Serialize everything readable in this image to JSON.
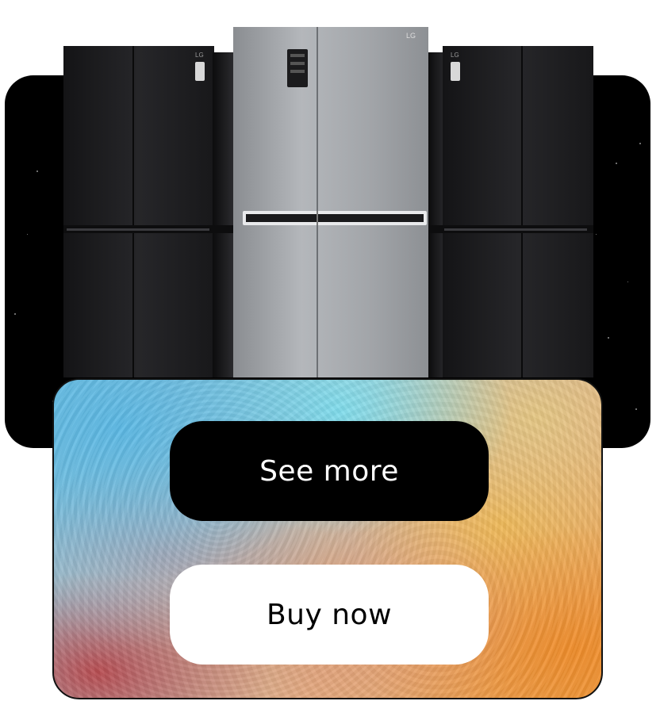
{
  "product_image": {
    "icon": "refrigerator-lineup-image",
    "colors": {
      "backdrop": "#000000",
      "dark_fridge": "#1e1e21",
      "steel_fridge": "#9fa2a6"
    }
  },
  "actions": {
    "see_more_label": "See more",
    "buy_now_label": "Buy now"
  },
  "colors": {
    "primary_button_bg": "#000000",
    "primary_button_text": "#ffffff",
    "secondary_button_bg": "#ffffff",
    "secondary_button_text": "#000000"
  }
}
